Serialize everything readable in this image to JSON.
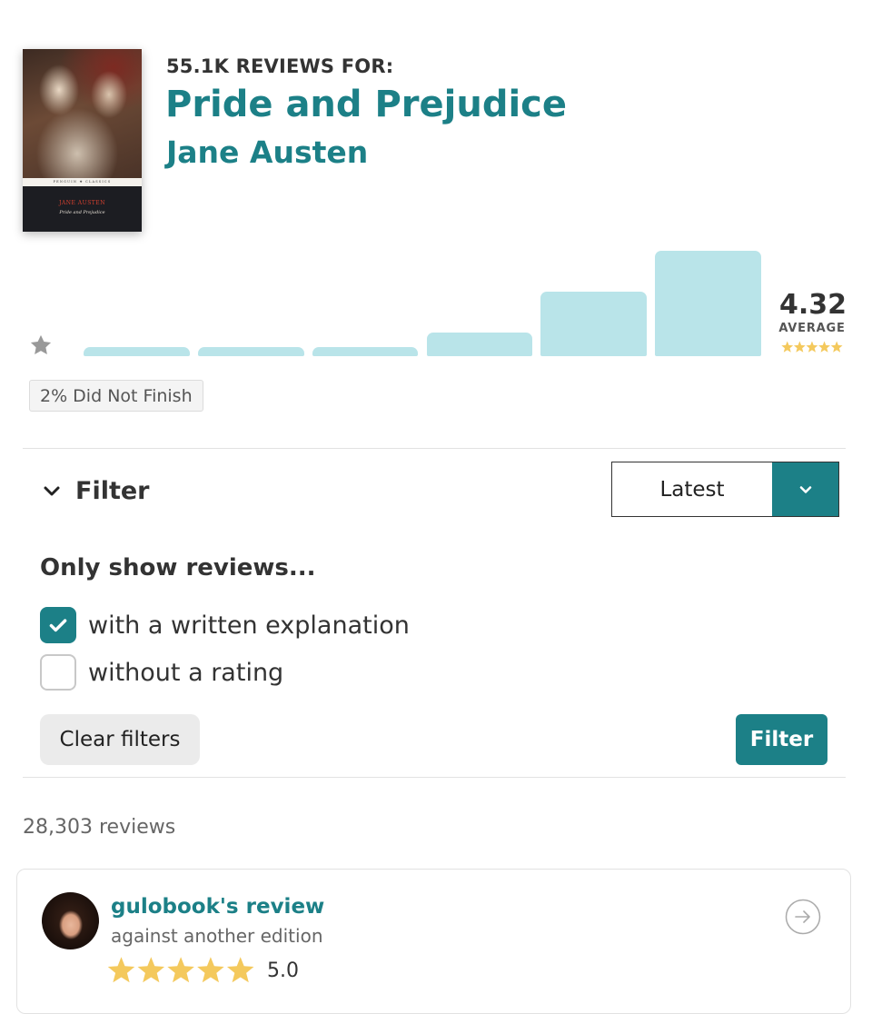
{
  "book": {
    "reviews_for": "55.1K REVIEWS FOR:",
    "title": "Pride and Prejudice",
    "author": "Jane Austen",
    "cover": {
      "publisher_band": "PENGUIN ❖ CLASSICS",
      "author": "JANE AUSTEN",
      "title": "Pride and Prejudice"
    }
  },
  "rating_summary": {
    "average": "4.32",
    "average_label": "AVERAGE",
    "distribution_fraction_of_max": [
      0.08,
      0.08,
      0.08,
      0.22,
      0.61,
      1.0
    ],
    "bar_color": "#b9e4e9",
    "did_not_finish": "2% Did Not Finish"
  },
  "filter": {
    "toggle_label": "Filter",
    "sort_value": "Latest",
    "heading": "Only show reviews...",
    "options": [
      {
        "label": "with a written explanation",
        "checked": true
      },
      {
        "label": "without a rating",
        "checked": false
      }
    ],
    "clear_label": "Clear filters",
    "apply_label": "Filter"
  },
  "reviews": {
    "count_text": "28,303 reviews",
    "items": [
      {
        "name": "gulobook's review",
        "subtitle": "against another edition",
        "stars": 5,
        "rating": "5.0"
      }
    ]
  },
  "colors": {
    "accent": "#1c8087",
    "star_yellow": "#f4c95d",
    "star_gray": "#999999"
  }
}
